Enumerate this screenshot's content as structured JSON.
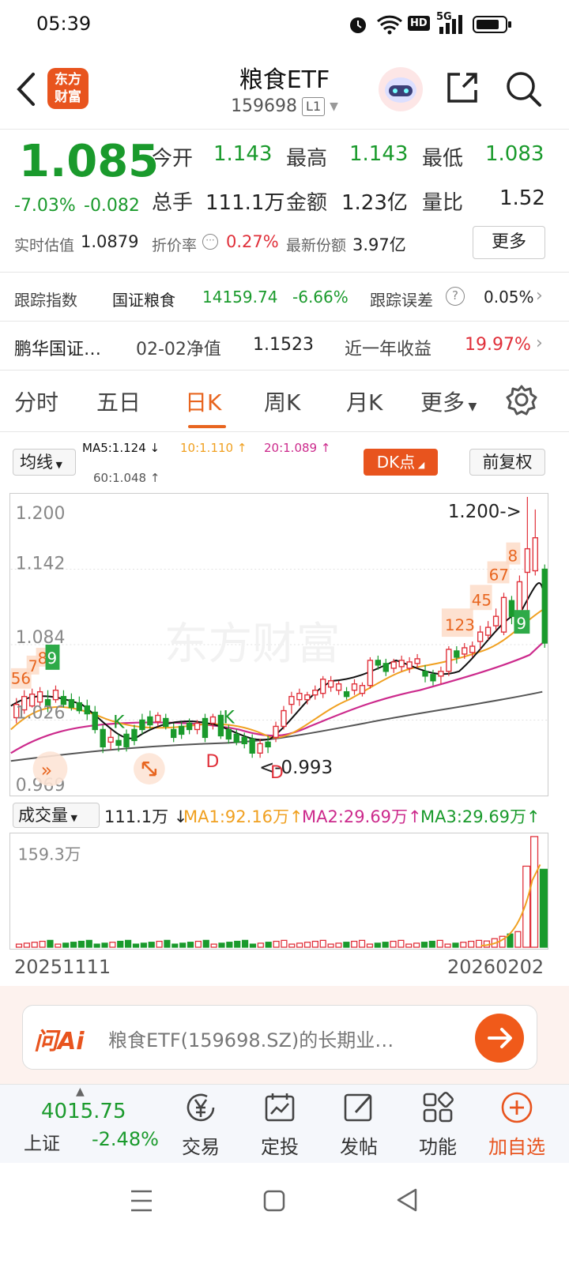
{
  "status": {
    "time": "05:39",
    "network": "5G",
    "hd": "HD"
  },
  "nav": {
    "title": "粮食ETF",
    "code": "159698",
    "badge": "L1",
    "logo_text_1": "东方",
    "logo_text_2": "财富"
  },
  "quote": {
    "price": "1.085",
    "change_pct": "-7.03%",
    "change": "-0.082",
    "open_label": "今开",
    "open": "1.143",
    "high_label": "最高",
    "high": "1.143",
    "low_label": "最低",
    "low": "1.083",
    "volume_label": "总手",
    "volume": "111.1万",
    "amount_label": "金额",
    "amount": "1.23亿",
    "ratio_label": "量比",
    "ratio": "1.52",
    "iopv_label": "实时估值",
    "iopv": "1.0879",
    "premium_label": "折价率",
    "premium": "0.27%",
    "shares_label": "最新份额",
    "shares": "3.97亿",
    "more_button": "更多"
  },
  "tracking": {
    "label": "跟踪指数",
    "index_name": "国证粮食",
    "index_value": "14159.74",
    "index_change": "-6.66%",
    "error_label": "跟踪误差",
    "error_value": "0.05%"
  },
  "fund": {
    "name": "鹏华国证…",
    "nav_label": "02-02净值",
    "nav_value": "1.1523",
    "return_label": "近一年收益",
    "return_value": "19.97%"
  },
  "tabs": [
    "分时",
    "五日",
    "日K",
    "周K",
    "月K",
    "更多"
  ],
  "active_tab": "日K",
  "ma_bar": {
    "selector": "均线",
    "ma5": "MA5:1.124",
    "ma10": "10:1.110",
    "ma20": "20:1.089",
    "ma60": "60:1.048",
    "dk_button": "DK点",
    "adjust_button": "前复权"
  },
  "chart_data": {
    "type": "candlestick",
    "y_ticks": [
      "1.200",
      "1.142",
      "1.084",
      "1.026",
      "0.969"
    ],
    "x_start": "20251111",
    "x_end": "20260202",
    "high_annotation": "1.200->",
    "low_annotation": "<-0.993",
    "counter_labels": [
      "56",
      "7",
      "8",
      "9",
      "123",
      "45",
      "67",
      "8",
      "9"
    ],
    "signal_labels": [
      "K",
      "K",
      "D",
      "D"
    ],
    "watermark": "东方财富",
    "colors": {
      "up": "#e0303a",
      "down": "#1a9a2c",
      "ma5": "#111111",
      "ma10": "#f0a020",
      "ma20": "#cc2a8c",
      "ma60": "#555555"
    }
  },
  "volume": {
    "selector": "成交量",
    "current": "111.1万",
    "ma1": "MA1:92.16万",
    "ma2": "MA2:29.69万",
    "ma3": "MA3:29.69万",
    "max_label": "159.3万",
    "date_start": "20251111",
    "date_end": "20260202"
  },
  "ai_bar": {
    "brand": "问Ai",
    "prompt": "粮食ETF(159698.SZ)的长期业…"
  },
  "bottom_nav": {
    "index_value": "4015.75",
    "index_name": "上证",
    "index_change": "-2.48%",
    "items": [
      "交易",
      "定投",
      "发帖",
      "功能",
      "加自选"
    ]
  }
}
